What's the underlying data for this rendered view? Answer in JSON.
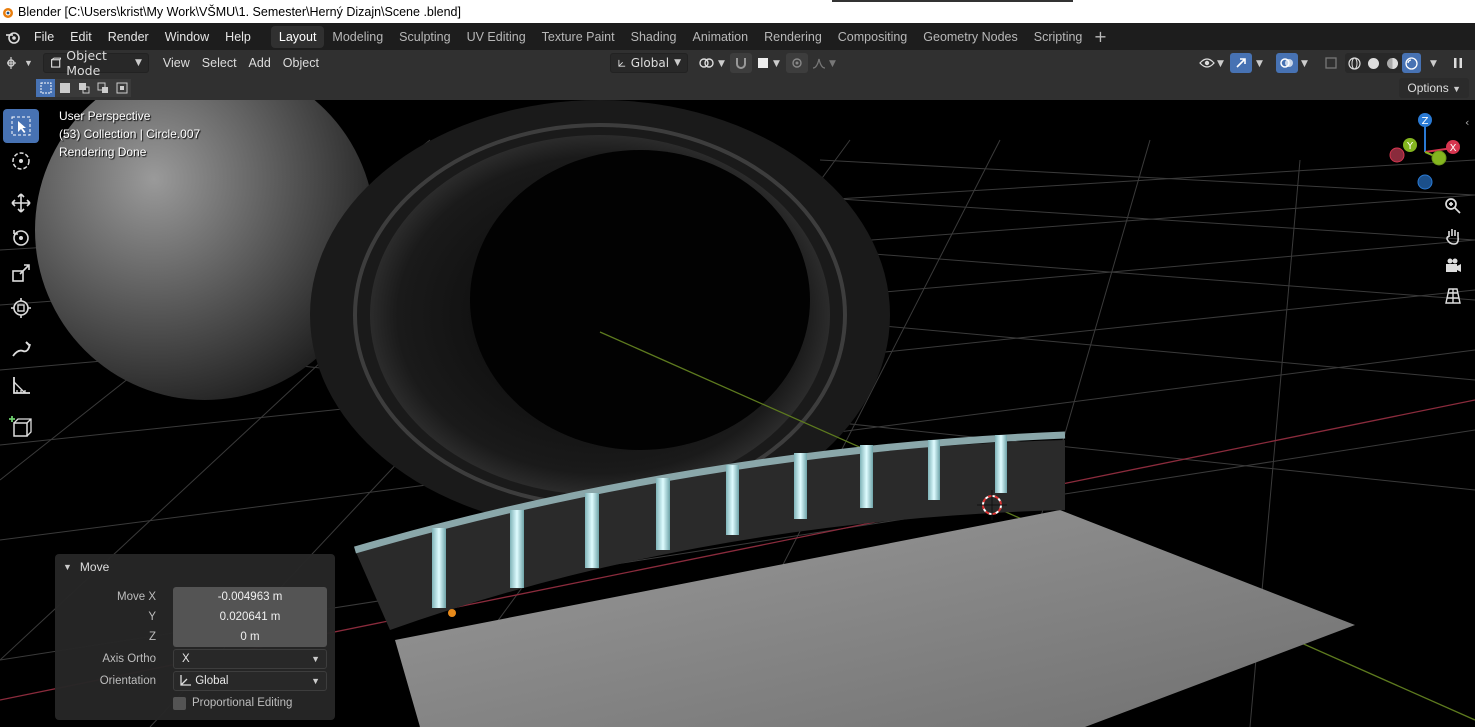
{
  "window": {
    "title": "Blender [C:\\Users\\krist\\My Work\\VŠMU\\1. Semester\\Herný Dizajn\\Scene .blend]"
  },
  "menu": [
    "File",
    "Edit",
    "Render",
    "Window",
    "Help"
  ],
  "workspaces": {
    "tabs": [
      "Layout",
      "Modeling",
      "Sculpting",
      "UV Editing",
      "Texture Paint",
      "Shading",
      "Animation",
      "Rendering",
      "Compositing",
      "Geometry Nodes",
      "Scripting"
    ],
    "active": "Layout"
  },
  "header": {
    "mode": "Object Mode",
    "view": "View",
    "select": "Select",
    "add": "Add",
    "object": "Object",
    "orientation": "Global"
  },
  "toolsettings": {
    "options": "Options"
  },
  "viewport": {
    "perspective": "User Perspective",
    "collection": "(53) Collection | Circle.007",
    "status": "Rendering Done"
  },
  "gizmo": {
    "x": "X",
    "y": "Y",
    "z": "Z",
    "colors": {
      "x": "#d6354f",
      "y": "#84b51f",
      "z": "#2a7ad4"
    }
  },
  "operator": {
    "title": "Move",
    "move_x_label": "Move X",
    "move_x": "-0.004963 m",
    "y_label": "Y",
    "y": "0.020641 m",
    "z_label": "Z",
    "z": "0 m",
    "axis_ortho_label": "Axis Ortho",
    "axis_ortho": "X",
    "orientation_label": "Orientation",
    "orientation": "Global",
    "proportional_label": "Proportional Editing"
  },
  "colors": {
    "accent": "#4772b3",
    "header": "#303030",
    "topbar": "#1d1d1d"
  }
}
